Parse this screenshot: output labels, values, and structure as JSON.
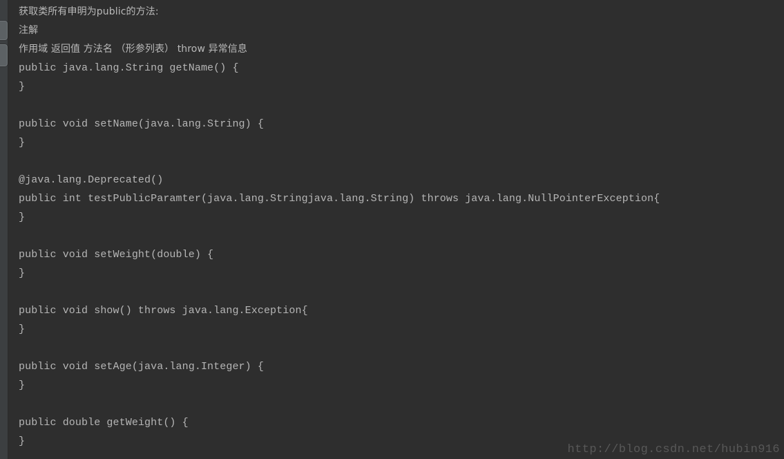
{
  "window": {
    "theme_background": "#2e2e2e",
    "stripe_background": "#3c3f41",
    "text_color": "#b6b6b6"
  },
  "tool_stripe": {
    "buttons": [
      {
        "name": "structure",
        "label": ""
      },
      {
        "name": "favorites",
        "label": ""
      }
    ]
  },
  "console": {
    "lines": [
      {
        "text": "获取类所有申明为public的方法:",
        "cjk": true
      },
      {
        "text": "注解",
        "cjk": true
      },
      {
        "text": "作用域 返回值 方法名 （形参列表） throw 异常信息",
        "cjk": true
      },
      {
        "text": "public java.lang.String getName() {",
        "cjk": false
      },
      {
        "text": "}",
        "cjk": false
      },
      {
        "text": "",
        "cjk": false
      },
      {
        "text": "public void setName(java.lang.String) {",
        "cjk": false
      },
      {
        "text": "}",
        "cjk": false
      },
      {
        "text": "",
        "cjk": false
      },
      {
        "text": "@java.lang.Deprecated()",
        "cjk": false
      },
      {
        "text": "public int testPublicParamter(java.lang.Stringjava.lang.String) throws java.lang.NullPointerException{",
        "cjk": false
      },
      {
        "text": "}",
        "cjk": false
      },
      {
        "text": "",
        "cjk": false
      },
      {
        "text": "public void setWeight(double) {",
        "cjk": false
      },
      {
        "text": "}",
        "cjk": false
      },
      {
        "text": "",
        "cjk": false
      },
      {
        "text": "public void show() throws java.lang.Exception{",
        "cjk": false
      },
      {
        "text": "}",
        "cjk": false
      },
      {
        "text": "",
        "cjk": false
      },
      {
        "text": "public void setAge(java.lang.Integer) {",
        "cjk": false
      },
      {
        "text": "}",
        "cjk": false
      },
      {
        "text": "",
        "cjk": false
      },
      {
        "text": "public double getWeight() {",
        "cjk": false
      },
      {
        "text": "}",
        "cjk": false
      }
    ]
  },
  "watermark": {
    "text": "http://blog.csdn.net/hubin916"
  }
}
